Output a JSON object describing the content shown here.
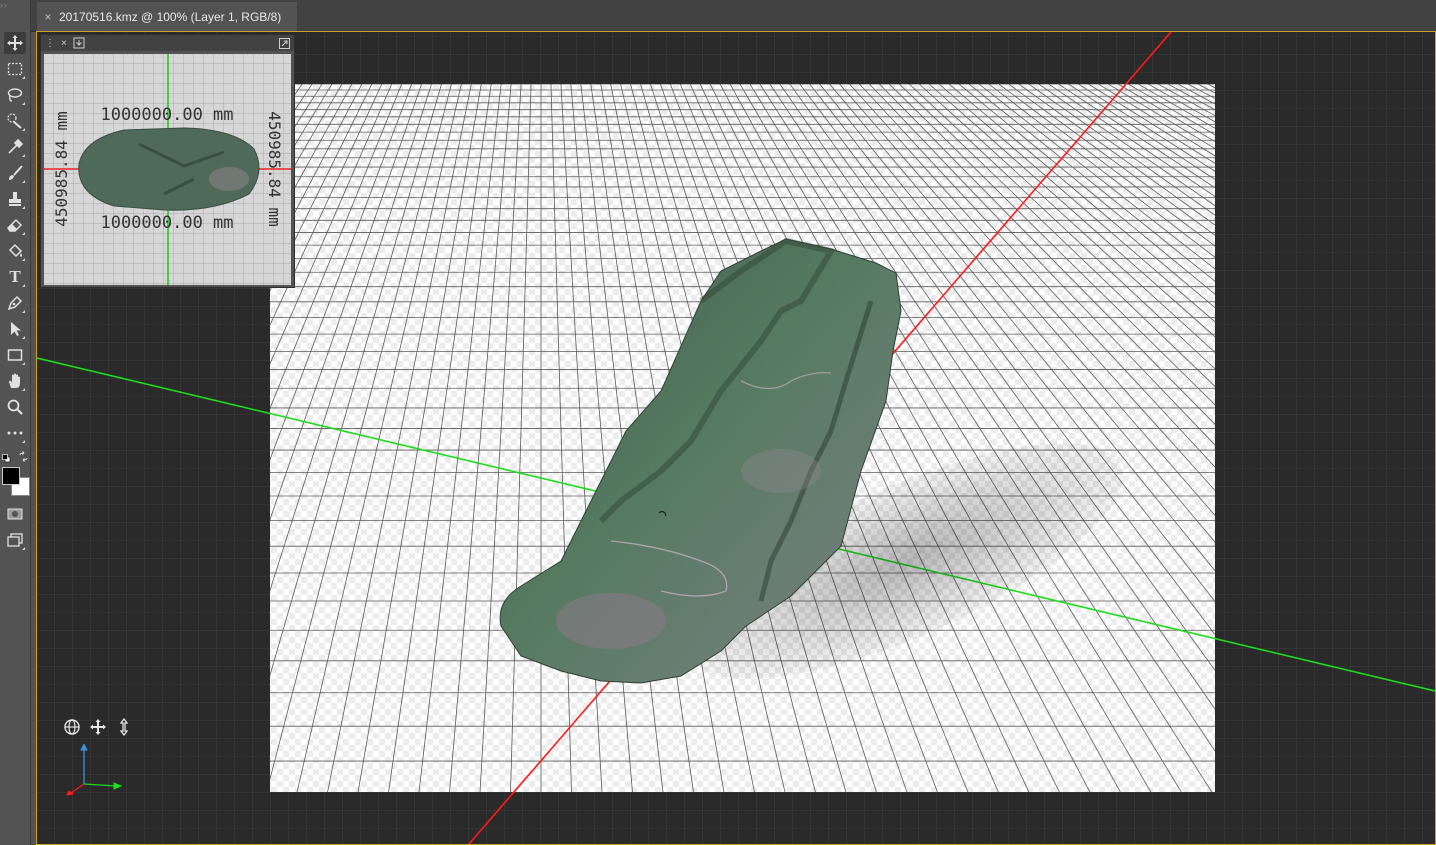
{
  "document": {
    "tab_title": "20170516.kmz @ 100% (Layer 1, RGB/8)",
    "close_glyph": "×"
  },
  "toolbar": {
    "grip": "››",
    "tools": [
      {
        "name": "move-tool",
        "icon": "move-icon"
      },
      {
        "name": "rectangular-marquee-tool",
        "icon": "marquee-icon"
      },
      {
        "name": "lasso-tool",
        "icon": "lasso-icon"
      },
      {
        "name": "quick-selection-tool",
        "icon": "quick-selection-icon"
      },
      {
        "name": "eyedropper-tool",
        "icon": "eyedropper-icon"
      },
      {
        "name": "brush-tool",
        "icon": "brush-icon"
      },
      {
        "name": "clone-stamp-tool",
        "icon": "stamp-icon"
      },
      {
        "name": "eraser-tool",
        "icon": "eraser-icon"
      },
      {
        "name": "paint-bucket-tool",
        "icon": "bucket-icon"
      },
      {
        "name": "type-tool",
        "icon": "type-icon",
        "label": "T"
      },
      {
        "name": "pen-tool",
        "icon": "pen-icon"
      },
      {
        "name": "path-selection-tool",
        "icon": "arrow-icon"
      },
      {
        "name": "rectangle-tool",
        "icon": "rectangle-icon"
      },
      {
        "name": "hand-tool",
        "icon": "hand-icon"
      },
      {
        "name": "zoom-tool",
        "icon": "zoom-icon"
      },
      {
        "name": "edit-toolbar",
        "icon": "more-icon"
      }
    ],
    "foreground_color": "#000000",
    "background_color": "#ffffff"
  },
  "navigator": {
    "menu_glyph": "⋮",
    "close_glyph": "×",
    "labels": {
      "top": "1000000.00 mm",
      "bottom": "1000000.00 mm",
      "left": "450985.84 mm",
      "right": "450985.84 mm"
    }
  },
  "scene": {
    "x_axis_color": "#ff1a1a",
    "y_axis_color": "#1ddc1d",
    "z_axis_color": "#3a8fd8",
    "ground_grid": true,
    "view_controls": [
      "orbit-3d-icon",
      "pan-3d-icon",
      "dolly-3d-icon"
    ]
  }
}
